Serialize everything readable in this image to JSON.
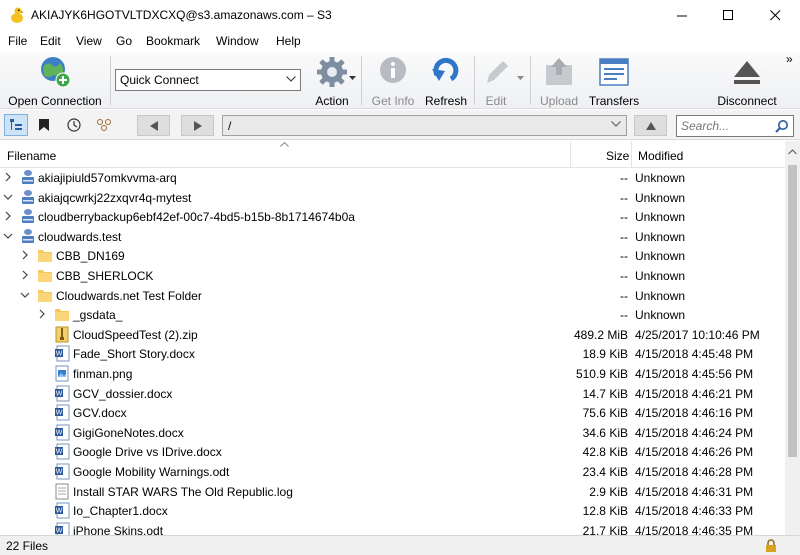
{
  "window": {
    "title": "AKIAJYK6HGOTVLTDXCXQ@s3.amazonaws.com – S3"
  },
  "menu": [
    "File",
    "Edit",
    "View",
    "Go",
    "Bookmark",
    "Window",
    "Help"
  ],
  "toolbar": {
    "open_connection": "Open Connection",
    "quick_connect": "Quick Connect",
    "action": "Action",
    "get_info": "Get Info",
    "refresh": "Refresh",
    "edit": "Edit",
    "upload": "Upload",
    "transfers": "Transfers",
    "disconnect": "Disconnect"
  },
  "navbar": {
    "path": "/",
    "search_placeholder": "Search..."
  },
  "columns": {
    "filename": "Filename",
    "size": "Size",
    "modified": "Modified"
  },
  "files": [
    {
      "name": "akiajipiuld57omkvvma-arq",
      "size": "--",
      "modified": "Unknown",
      "type": "bucket",
      "level": 0,
      "expander": "collapsed"
    },
    {
      "name": "akiajqcwrkj22zxqvr4q-mytest",
      "size": "--",
      "modified": "Unknown",
      "type": "bucket",
      "level": 0,
      "expander": "expanded"
    },
    {
      "name": "cloudberrybackup6ebf42ef-00c7-4bd5-b15b-8b1714674b0a",
      "size": "--",
      "modified": "Unknown",
      "type": "bucket",
      "level": 0,
      "expander": "collapsed"
    },
    {
      "name": "cloudwards.test",
      "size": "--",
      "modified": "Unknown",
      "type": "bucket",
      "level": 0,
      "expander": "expanded"
    },
    {
      "name": "CBB_DN169",
      "size": "--",
      "modified": "Unknown",
      "type": "folder",
      "level": 1,
      "expander": "collapsed"
    },
    {
      "name": "CBB_SHERLOCK",
      "size": "--",
      "modified": "Unknown",
      "type": "folder",
      "level": 1,
      "expander": "collapsed"
    },
    {
      "name": "Cloudwards.net Test Folder",
      "size": "--",
      "modified": "Unknown",
      "type": "folder",
      "level": 1,
      "expander": "expanded"
    },
    {
      "name": "_gsdata_",
      "size": "--",
      "modified": "Unknown",
      "type": "folder",
      "level": 2,
      "expander": "collapsed"
    },
    {
      "name": "CloudSpeedTest (2).zip",
      "size": "489.2 MiB",
      "modified": "4/25/2017 10:10:46 PM",
      "type": "zip",
      "level": 2,
      "expander": "none"
    },
    {
      "name": "Fade_Short Story.docx",
      "size": "18.9 KiB",
      "modified": "4/15/2018 4:45:48 PM",
      "type": "word",
      "level": 2,
      "expander": "none"
    },
    {
      "name": "finman.png",
      "size": "510.9 KiB",
      "modified": "4/15/2018 4:45:56 PM",
      "type": "image",
      "level": 2,
      "expander": "none"
    },
    {
      "name": "GCV_dossier.docx",
      "size": "14.7 KiB",
      "modified": "4/15/2018 4:46:21 PM",
      "type": "word",
      "level": 2,
      "expander": "none"
    },
    {
      "name": "GCV.docx",
      "size": "75.6 KiB",
      "modified": "4/15/2018 4:46:16 PM",
      "type": "word",
      "level": 2,
      "expander": "none"
    },
    {
      "name": "GigiGoneNotes.docx",
      "size": "34.6 KiB",
      "modified": "4/15/2018 4:46:24 PM",
      "type": "word",
      "level": 2,
      "expander": "none"
    },
    {
      "name": "Google Drive vs IDrive.docx",
      "size": "42.8 KiB",
      "modified": "4/15/2018 4:46:26 PM",
      "type": "word",
      "level": 2,
      "expander": "none"
    },
    {
      "name": "Google Mobility Warnings.odt",
      "size": "23.4 KiB",
      "modified": "4/15/2018 4:46:28 PM",
      "type": "word",
      "level": 2,
      "expander": "none"
    },
    {
      "name": "Install STAR WARS The Old Republic.log",
      "size": "2.9 KiB",
      "modified": "4/15/2018 4:46:31 PM",
      "type": "text",
      "level": 2,
      "expander": "none"
    },
    {
      "name": "Io_Chapter1.docx",
      "size": "12.8 KiB",
      "modified": "4/15/2018 4:46:33 PM",
      "type": "word",
      "level": 2,
      "expander": "none"
    },
    {
      "name": "iPhone Skins.odt",
      "size": "21.7 KiB",
      "modified": "4/15/2018 4:46:35 PM",
      "type": "word",
      "level": 2,
      "expander": "none"
    }
  ],
  "status": {
    "count": "22 Files"
  }
}
